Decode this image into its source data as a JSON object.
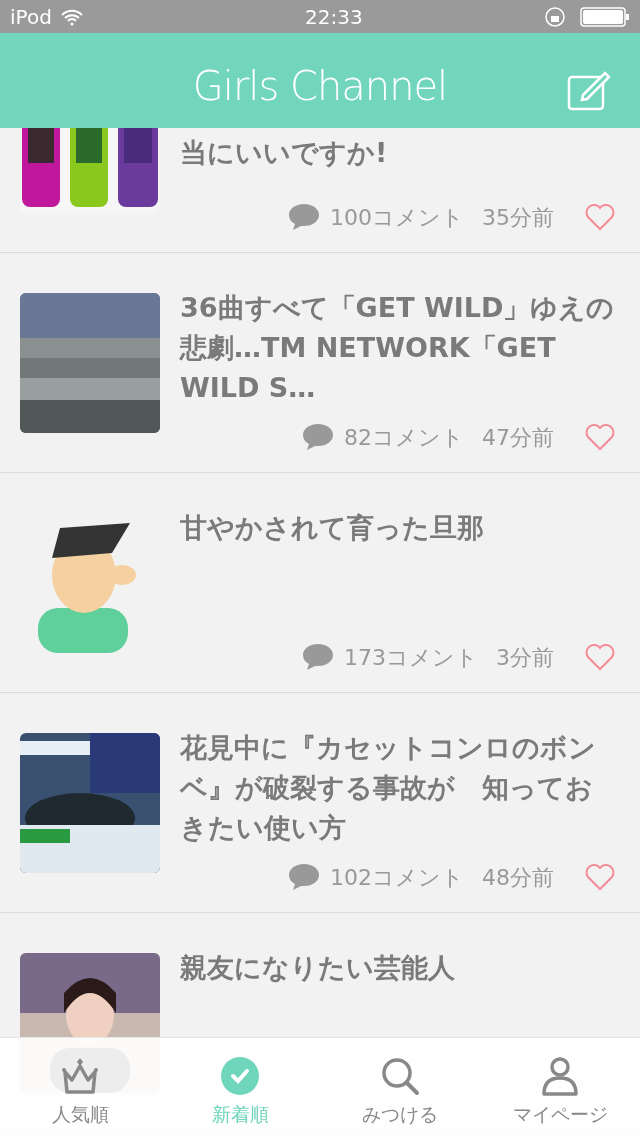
{
  "status_bar": {
    "carrier": "iPod",
    "time": "22:33"
  },
  "header": {
    "title": "Girls Channel"
  },
  "topics": [
    {
      "kind": "cut",
      "title": "当にいいですか!",
      "comments": "100コメント",
      "time": "35分前",
      "liked": false
    },
    {
      "kind": "full",
      "title": "36曲すべて「GET WILD」ゆえの悲劇…TM NETWORK「GET WILD S…",
      "comments": "82コメント",
      "time": "47分前",
      "liked": false
    },
    {
      "kind": "full",
      "title": "甘やかされて育った旦那",
      "comments": "173コメント",
      "time": "3分前",
      "liked": false
    },
    {
      "kind": "full",
      "title": "花見中に『カセットコンロのボンベ』が破裂する事故が　知っておきたい使い方",
      "comments": "102コメント",
      "time": "48分前",
      "liked": false
    },
    {
      "kind": "full",
      "title": "親友になりたい芸能人"
    }
  ],
  "tabs": [
    {
      "label": "人気順",
      "selected": false
    },
    {
      "label": "新着順",
      "selected": true
    },
    {
      "label": "みつける",
      "selected": false
    },
    {
      "label": "マイページ",
      "selected": false
    }
  ]
}
